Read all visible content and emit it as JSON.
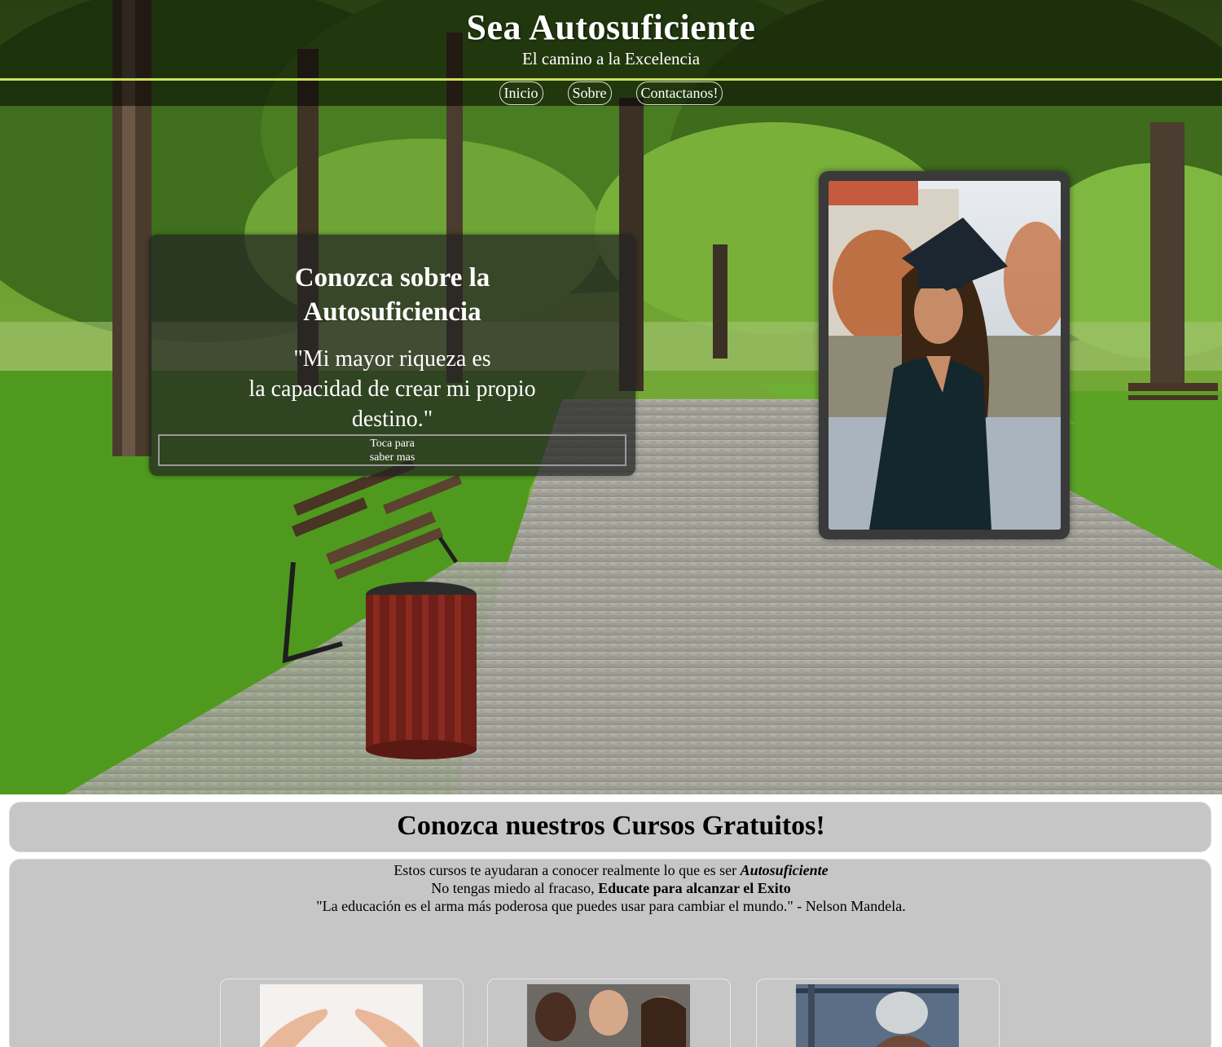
{
  "header": {
    "title": "Sea Autosuficiente",
    "subtitle": "El camino a la Excelencia"
  },
  "nav": {
    "items": [
      "Inicio",
      "Sobre",
      "Contactanos!"
    ]
  },
  "info_card": {
    "title_line1": "Conozca sobre la",
    "title_line2": "Autosuficiencia",
    "quote_line1": "\"Mi mayor riqueza es",
    "quote_line2": "la capacidad de crear mi propio",
    "quote_line3": "destino.\"",
    "button_line1": "Toca para",
    "button_line2": "saber mas"
  },
  "courses": {
    "title": "Conozca nuestros Cursos Gratuitos!",
    "line1_prefix": "Estos cursos te ayudaran a conocer realmente lo que es ser ",
    "line1_emphasis": "Autosuficiente",
    "line2_prefix": "No tengas miedo al fracaso, ",
    "line2_bold": "Educate para alcanzar el Exito",
    "line3": "\"La educación es el arma más poderosa que puedes usar para cambiar el mundo.\" - Nelson Mandela."
  },
  "colors": {
    "accent_line": "#c9e25a",
    "panel_gray": "#c6c6c6",
    "overlay_dark": "rgba(0,0,0,0.55)"
  }
}
